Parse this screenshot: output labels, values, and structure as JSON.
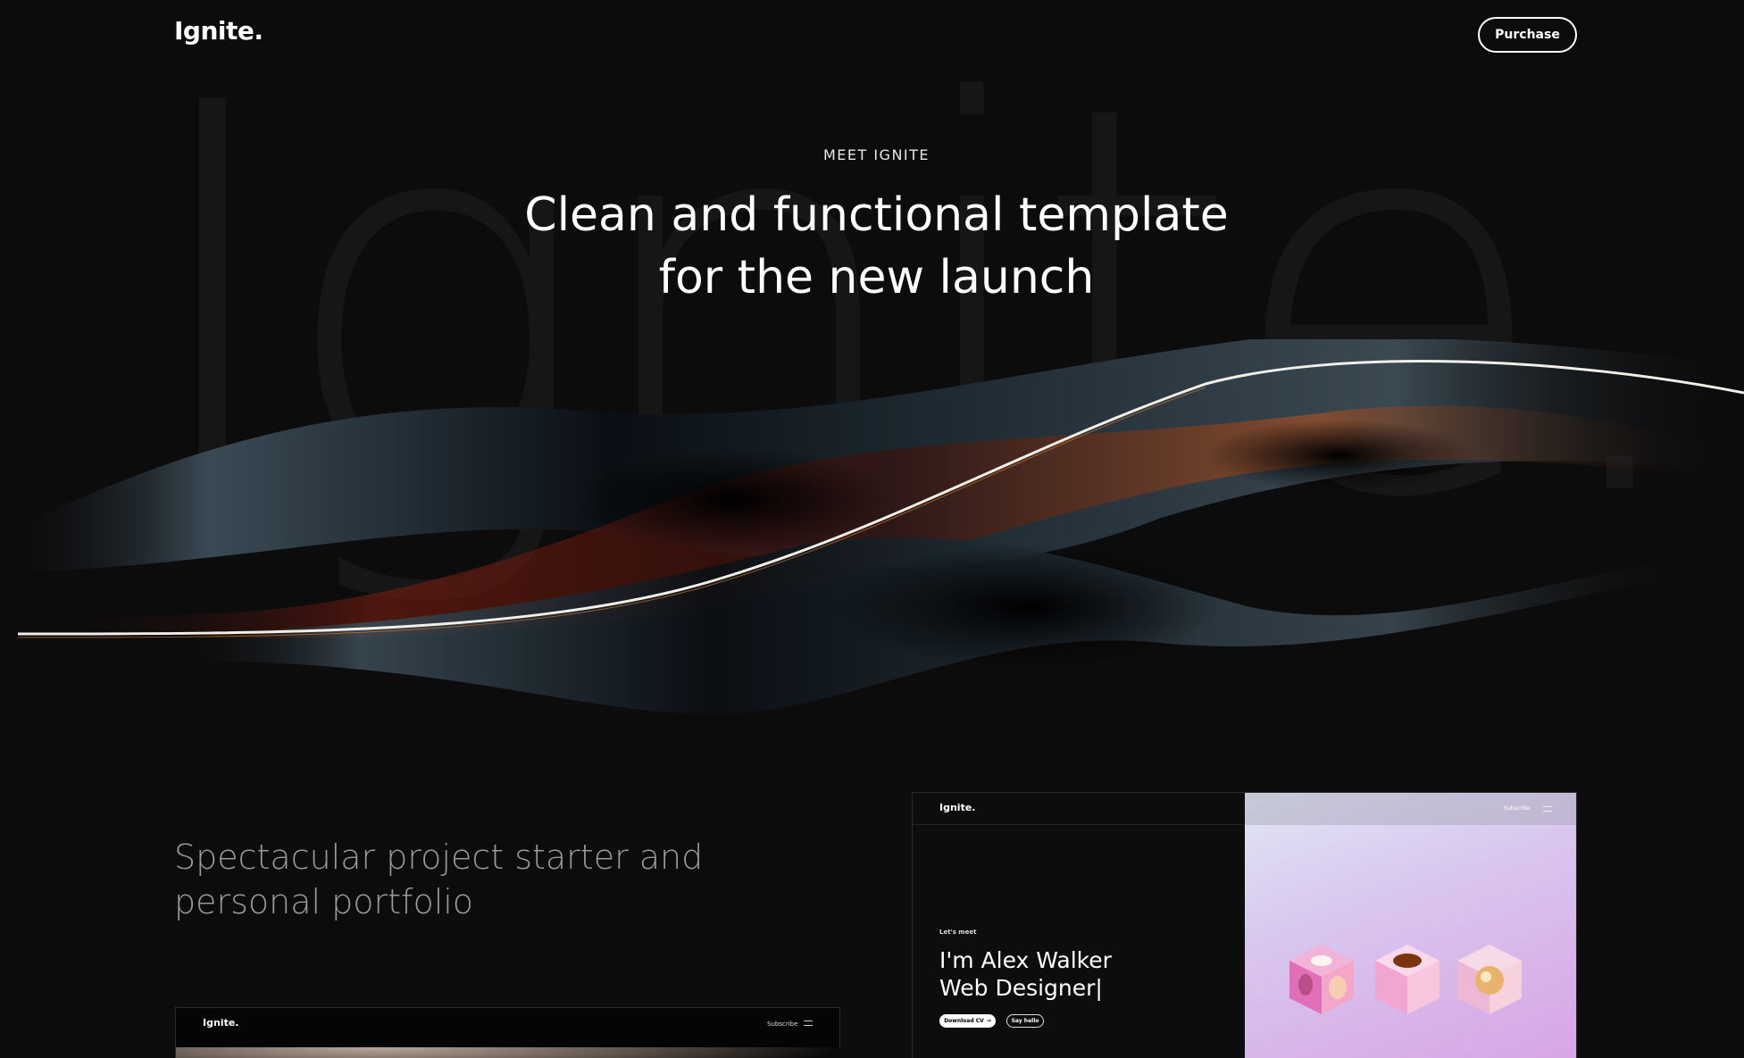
{
  "header": {
    "logo": "Ignite.",
    "purchase_label": "Purchase"
  },
  "hero": {
    "background_word": "Ignite.",
    "eyebrow": "MEET IGNITE",
    "title_line1": "Clean and functional template",
    "title_line2": "for the new launch"
  },
  "section": {
    "subtitle_line1": "Spectacular project starter and",
    "subtitle_line2": "personal portfolio"
  },
  "preview_small": {
    "logo": "Ignite.",
    "subscribe": "Subscribe"
  },
  "preview_large": {
    "logo": "Ignite.",
    "subscribe": "Subscribe",
    "eyebrow": "Let's meet",
    "title_line1": "I'm Alex Walker",
    "title_line2": "Web Designer|",
    "download_label": "Download CV",
    "hello_label": "Say hello"
  },
  "colors": {
    "background": "#0c0c0c",
    "text": "#ffffff",
    "muted": "#9a9a9a",
    "bg_word": "#161616"
  }
}
